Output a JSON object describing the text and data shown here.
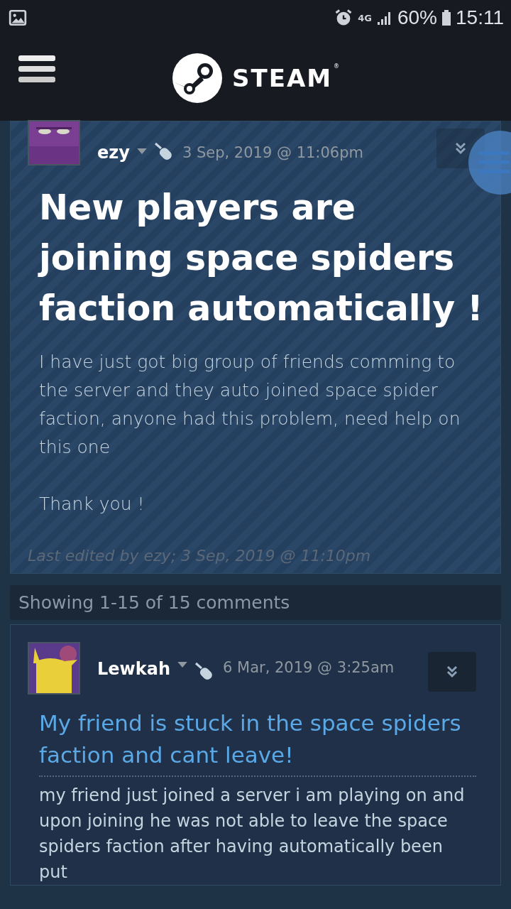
{
  "status_bar": {
    "battery_text": "60%",
    "time": "15:11",
    "network": "4G"
  },
  "header": {
    "logo_text": "STEAM",
    "logo_mark": "®"
  },
  "topic": {
    "author": "ezy",
    "date": "3 Sep, 2019 @ 11:06pm",
    "title": "New players are joining space spiders faction automatically !",
    "body": [
      "I have just got big group of friends comming to the server and they auto joined space spider faction, anyone had this problem, need help on this one",
      "Thank you !"
    ],
    "edited": "Last edited by ezy; 3 Sep, 2019 @ 11:10pm"
  },
  "comments_count": "Showing 1-15 of 15 comments",
  "comments": [
    {
      "author": "Lewkah",
      "date": "6 Mar, 2019 @ 3:25am",
      "title": "My friend is stuck in the space spiders faction and cant leave!",
      "body": "my friend just joined a server i am playing on and upon joining he was not able to leave the space spiders faction after having automatically been put"
    }
  ]
}
